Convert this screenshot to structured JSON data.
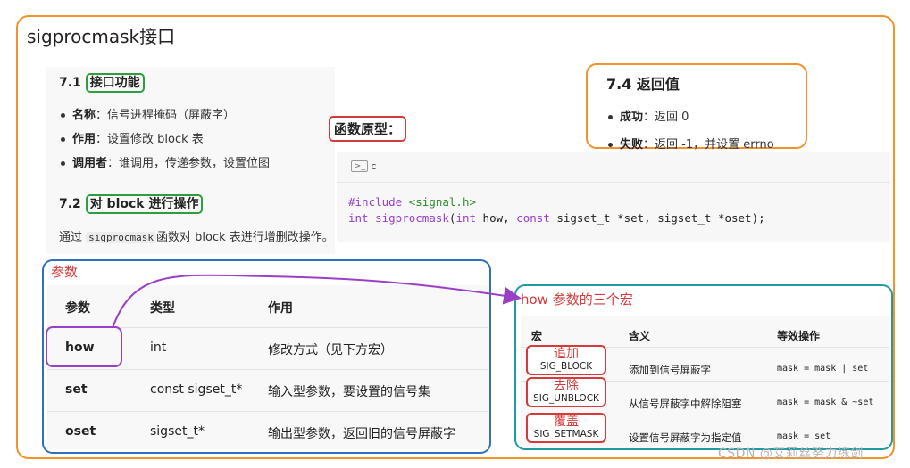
{
  "title": "sigprocmask接口",
  "section_71": {
    "heading_num": "7.1",
    "heading_text": "接口功能",
    "items": [
      {
        "label": "名称",
        "sep": "：",
        "text": "信号进程掩码（屏蔽字）"
      },
      {
        "label": "作用",
        "sep": "：",
        "text": "设置修改 block 表"
      },
      {
        "label": "调用者",
        "sep": "：",
        "text": "谁调用，传递参数，设置位图"
      }
    ]
  },
  "section_72": {
    "heading_num": "7.2",
    "heading_text": "对 block 进行操作",
    "desc_pre": "通过",
    "desc_code": "sigprocmask",
    "desc_post": "函数对 block 表进行增删改操作。"
  },
  "section_74": {
    "heading": "7.4 返回值",
    "items": [
      {
        "label": "成功",
        "sep": "：",
        "text": "返回 0"
      },
      {
        "label": "失败",
        "sep": "：",
        "text": "返回 -1，并设置 errno"
      }
    ]
  },
  "prototype": {
    "label": "函数原型：",
    "lang_icon": "terminal-icon",
    "lang": "c",
    "line1_directive": "#include",
    "line1_header": "<signal.h>",
    "line2_ret": "int",
    "line2_fn": "sigprocmask",
    "line2_open": "(",
    "line2_t1": "int",
    "line2_a1": " how, ",
    "line2_t2": "const",
    "line2_rest": " sigset_t *set, sigset_t *oset);"
  },
  "params": {
    "label": "参数",
    "headers": [
      "参数",
      "类型",
      "作用"
    ],
    "rows": [
      {
        "name": "how",
        "type": "int",
        "desc": "修改方式（见下方宏）"
      },
      {
        "name": "set",
        "type": "const sigset_t*",
        "desc": "输入型参数，要设置的信号集"
      },
      {
        "name": "oset",
        "type": "sigset_t*",
        "desc": "输出型参数，返回旧的信号屏蔽字"
      }
    ]
  },
  "how_macros": {
    "label": "how 参数的三个宏",
    "headers": [
      "宏",
      "含义",
      "等效操作"
    ],
    "rows": [
      {
        "tag": "追加",
        "macro": "SIG_BLOCK",
        "meaning": "添加到信号屏蔽字",
        "op": "mask = mask | set"
      },
      {
        "tag": "去除",
        "macro": "SIG_UNBLOCK",
        "meaning": "从信号屏蔽字中解除阻塞",
        "op": "mask = mask & ~set"
      },
      {
        "tag": "覆盖",
        "macro": "SIG_SETMASK",
        "meaning": "设置信号屏蔽字为指定值",
        "op": "mask = set"
      }
    ]
  },
  "colors": {
    "outer_frame": "#f0932b",
    "green_highlight": "#2e9c3f",
    "red_highlight": "#d63a3a",
    "params_frame": "#2f6fbf",
    "how_frame": "#1f9aa0",
    "arrow": "#9b3fc7"
  },
  "watermark": "CSDN @艾莉丝努力练剑"
}
